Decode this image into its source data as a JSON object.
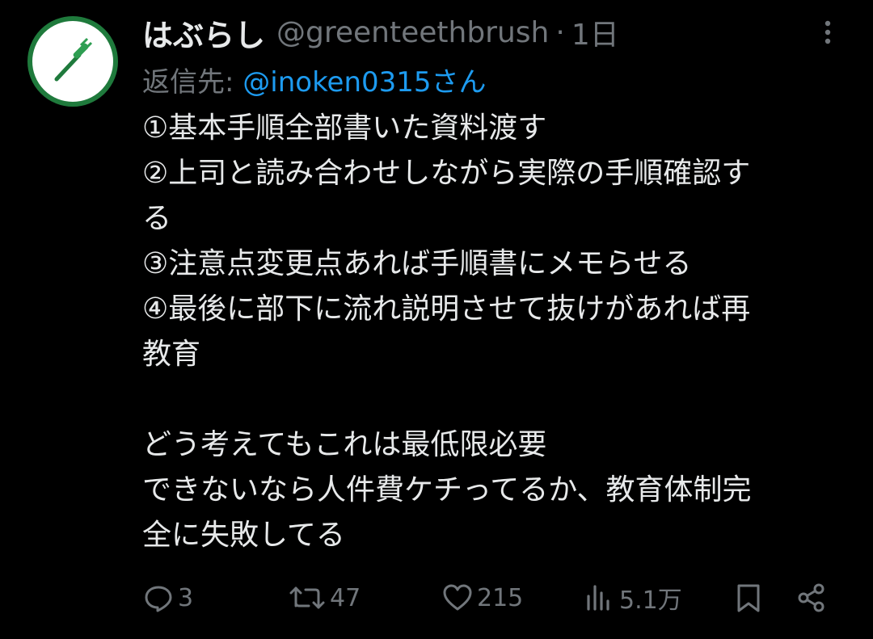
{
  "tweet": {
    "display_name": "はぶらし",
    "handle": "@greenteethbrush",
    "separator": "·",
    "time": "1日",
    "reply_prefix": "返信先: ",
    "reply_mention": "@inoken0315さん",
    "body_lines": [
      "①基本手順全部書いた資料渡す",
      "②上司と読み合わせしながら実際の手順確認す",
      "る",
      "③注意点変更点あれば手順書にメモらせる",
      "④最後に部下に流れ説明させて抜けがあれば再",
      "教育",
      "",
      "どう考えてもこれは最低限必要",
      "できないなら人件費ケチってるか、教育体制完",
      "全に失敗してる"
    ]
  },
  "actions": {
    "replies": "3",
    "reposts": "47",
    "likes": "215",
    "views": "5.1万"
  },
  "icons": {
    "avatar": "toothbrush-icon",
    "more": "more-vertical-icon",
    "reply": "reply-icon",
    "repost": "repost-icon",
    "like": "heart-icon",
    "views": "views-icon",
    "bookmark": "bookmark-icon",
    "share": "share-icon"
  },
  "colors": {
    "background": "#000000",
    "text": "#e7e9ea",
    "muted": "#71767b",
    "link": "#1d9bf0",
    "avatar_ring": "#1f7a3c"
  }
}
